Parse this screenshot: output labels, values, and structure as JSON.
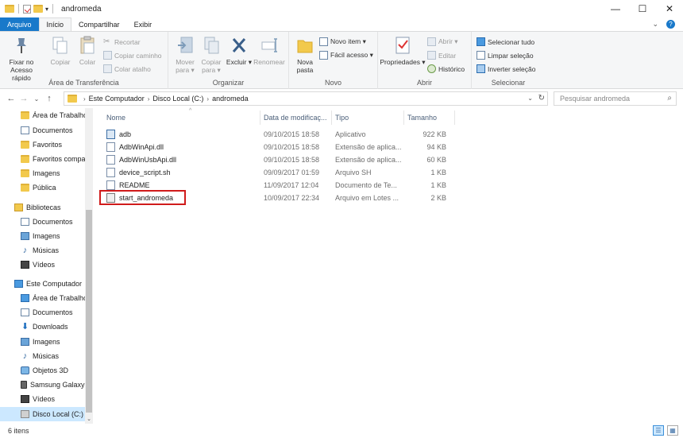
{
  "window": {
    "title": "andromeda",
    "minimize": "—",
    "maximize": "☐",
    "close": "✕"
  },
  "tabs": {
    "file": "Arquivo",
    "home": "Início",
    "share": "Compartilhar",
    "view": "Exibir"
  },
  "ribbon": {
    "clipboard": {
      "label": "Área de Transferência",
      "pin": "Fixar no Acesso rápido",
      "copy": "Copiar",
      "paste": "Colar",
      "cut": "Recortar",
      "copy_path": "Copiar caminho",
      "paste_shortcut": "Colar atalho"
    },
    "organize": {
      "label": "Organizar",
      "move_to": "Mover para ▾",
      "copy_to": "Copiar para ▾",
      "delete": "Excluir ▾",
      "rename": "Renomear"
    },
    "new": {
      "label": "Novo",
      "new_folder": "Nova pasta",
      "new_item": "Novo item ▾",
      "easy_access": "Fácil acesso ▾"
    },
    "open": {
      "label": "Abrir",
      "properties": "Propriedades ▾",
      "open": "Abrir ▾",
      "edit": "Editar",
      "history": "Histórico"
    },
    "select": {
      "label": "Selecionar",
      "select_all": "Selecionar tudo",
      "select_none": "Limpar seleção",
      "invert": "Inverter seleção"
    }
  },
  "address": {
    "crumbs": [
      "Este Computador",
      "Disco Local (C:)",
      "andromeda"
    ],
    "search_placeholder": "Pesquisar andromeda"
  },
  "nav": {
    "items": [
      {
        "label": "Área de Trabalho",
        "icon": "folder"
      },
      {
        "label": "Documentos",
        "icon": "doc"
      },
      {
        "label": "Favoritos",
        "icon": "folder"
      },
      {
        "label": "Favoritos compa",
        "icon": "folder"
      },
      {
        "label": "Imagens",
        "icon": "folder"
      },
      {
        "label": "Pública",
        "icon": "folder"
      },
      {
        "label": "Bibliotecas",
        "icon": "lib"
      },
      {
        "label": "Documentos",
        "icon": "doc"
      },
      {
        "label": "Imagens",
        "icon": "img"
      },
      {
        "label": "Músicas",
        "icon": "music"
      },
      {
        "label": "Vídeos",
        "icon": "video"
      },
      {
        "label": "Este Computador",
        "icon": "pc"
      },
      {
        "label": "Área de Trabalho",
        "icon": "pc"
      },
      {
        "label": "Documentos",
        "icon": "doc"
      },
      {
        "label": "Downloads",
        "icon": "dl"
      },
      {
        "label": "Imagens",
        "icon": "img"
      },
      {
        "label": "Músicas",
        "icon": "music"
      },
      {
        "label": "Objetos 3D",
        "icon": "3d"
      },
      {
        "label": "Samsung Galaxy",
        "icon": "phone"
      },
      {
        "label": "Vídeos",
        "icon": "video"
      },
      {
        "label": "Disco Local (C:)",
        "icon": "drive"
      }
    ]
  },
  "columns": {
    "name": "Nome",
    "date": "Data de modificaç...",
    "type": "Tipo",
    "size": "Tamanho"
  },
  "files": [
    {
      "name": "adb",
      "date": "09/10/2015 18:58",
      "type": "Aplicativo",
      "size": "922 KB",
      "icon": "app"
    },
    {
      "name": "AdbWinApi.dll",
      "date": "09/10/2015 18:58",
      "type": "Extensão de aplica...",
      "size": "94 KB",
      "icon": "dll"
    },
    {
      "name": "AdbWinUsbApi.dll",
      "date": "09/10/2015 18:58",
      "type": "Extensão de aplica...",
      "size": "60 KB",
      "icon": "dll"
    },
    {
      "name": "device_script.sh",
      "date": "09/09/2017 01:59",
      "type": "Arquivo SH",
      "size": "1 KB",
      "icon": "file"
    },
    {
      "name": "README",
      "date": "11/09/2017 12:04",
      "type": "Documento de Te...",
      "size": "1 KB",
      "icon": "file"
    },
    {
      "name": "start_andromeda",
      "date": "10/09/2017 22:34",
      "type": "Arquivo em Lotes ...",
      "size": "2 KB",
      "icon": "bat"
    }
  ],
  "status": {
    "count": "6 itens"
  },
  "colors": {
    "file_tab": "#1979ca",
    "highlight": "#d01b1b",
    "selection": "#cce8ff"
  }
}
